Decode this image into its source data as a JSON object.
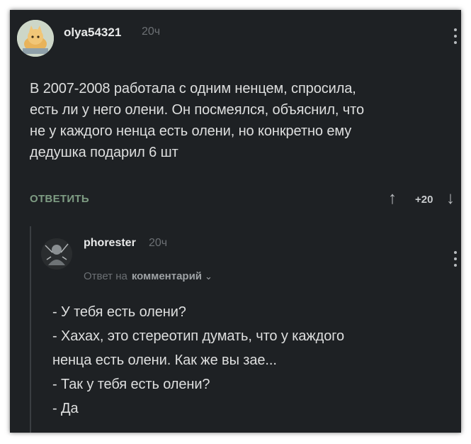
{
  "comment": {
    "username": "olya54321",
    "time": "20ч",
    "text": "В 2007-2008 работала с одним ненцем, спросила,\nесть ли у него олени. Он посмеялся, объяснил, что\nне у каждого ненца есть олени, но конкретно ему\nдедушка подарил 6 шт",
    "reply_label": "ОТВЕТИТЬ",
    "rating": "+20"
  },
  "reply_comment": {
    "username": "phorester",
    "time": "20ч",
    "reply_prefix": "Ответ на",
    "reply_target": "комментарий",
    "text": "- У тебя есть олени?\n- Хахах, это стереотип думать, что у каждого\nненца есть олени. Как же вы зае...\n- Так у тебя есть олени?\n- Да"
  },
  "icons": {
    "avatar1": "cat-avatar-icon",
    "avatar2": "user-avatar-icon",
    "menu": "kebab-menu-icon",
    "upvote": "arrow-up-icon",
    "downvote": "arrow-down-icon",
    "expand": "chevron-down-icon"
  },
  "colors": {
    "background": "#1e2124",
    "text": "#dedfdf",
    "accent": "#7e9c83",
    "muted": "#6c7074"
  }
}
